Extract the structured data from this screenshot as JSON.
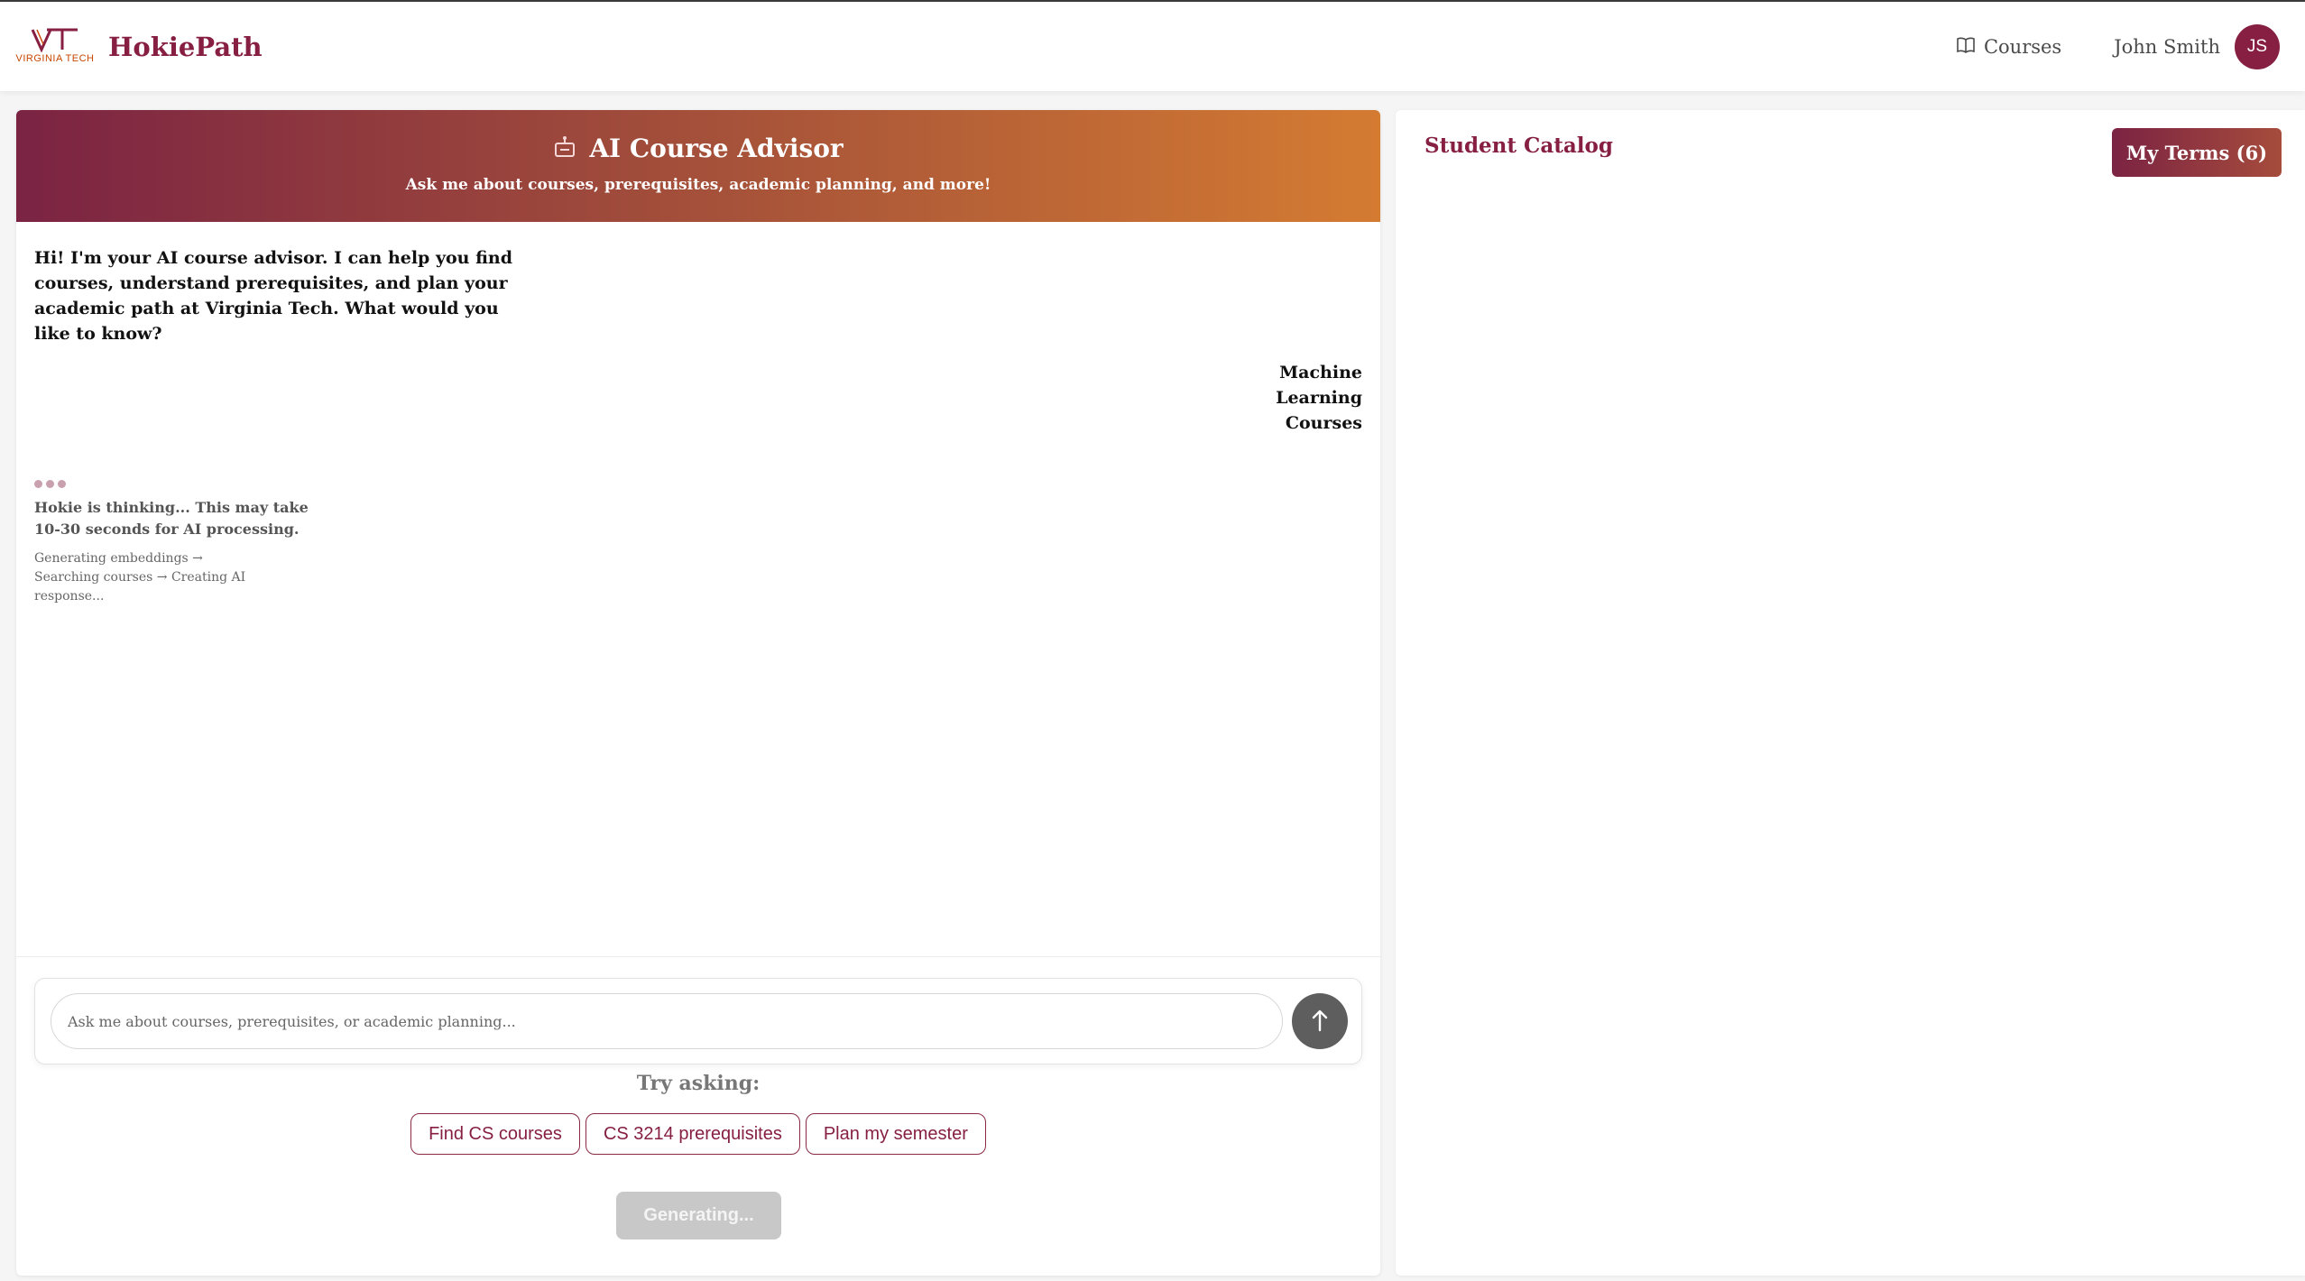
{
  "header": {
    "logo_text": "VT",
    "logo_subtext": "VIRGINIA TECH",
    "brand_name": "HokiePath",
    "nav_courses_label": "Courses",
    "nav_courses_icon": "book-icon",
    "user_name": "John Smith",
    "user_initials": "JS"
  },
  "chat": {
    "title": "AI Course Advisor",
    "title_icon": "robot-icon",
    "subtitle": "Ask me about courses, prerequisites, academic planning, and more!",
    "messages": [
      {
        "role": "assistant",
        "text": "Hi! I'm your AI course advisor. I can help you find courses, understand prerequisites, and plan your academic path at Virginia Tech. What would you like to know?"
      },
      {
        "role": "user",
        "text": "Machine Learning Courses"
      }
    ],
    "thinking": {
      "text": "Hokie is thinking... This may take 10-30 seconds for AI processing.",
      "steps": "Generating embeddings → Searching courses → Creating AI response..."
    },
    "input_placeholder": "Ask me about courses, prerequisites, or academic planning...",
    "send_icon": "arrow-up-icon",
    "try_label": "Try asking:",
    "suggestions": [
      "Find CS courses",
      "CS 3214 prerequisites",
      "Plan my semester"
    ],
    "generating_label": "Generating..."
  },
  "catalog": {
    "title": "Student Catalog",
    "terms_button_label": "My Terms (6)"
  },
  "colors": {
    "maroon": "#861f41",
    "orange": "#d47b32",
    "send_button": "#5e5e5e"
  }
}
